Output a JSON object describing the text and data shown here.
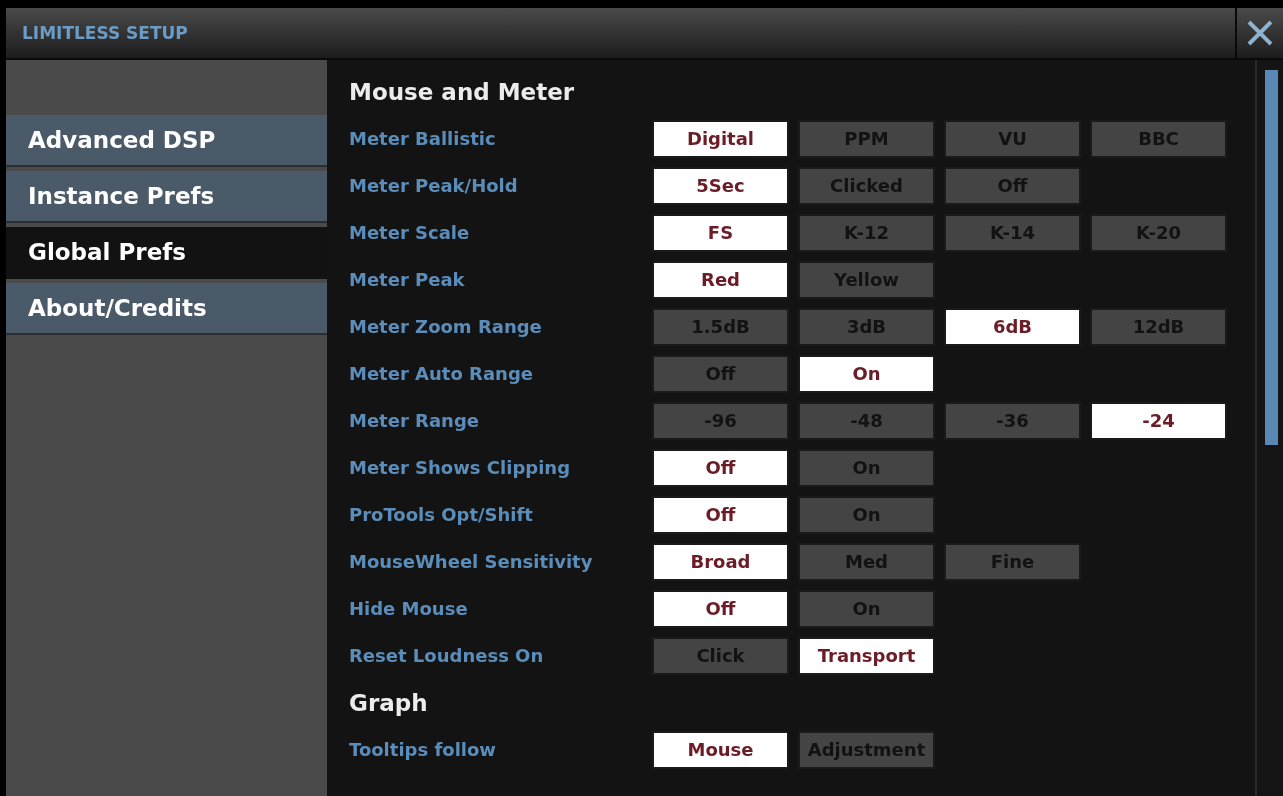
{
  "window": {
    "title": "LIMITLESS SETUP"
  },
  "sidebar": {
    "items": [
      {
        "label": "Advanced DSP",
        "selected": false
      },
      {
        "label": "Instance Prefs",
        "selected": false
      },
      {
        "label": "Global Prefs",
        "selected": true
      },
      {
        "label": "About/Credits",
        "selected": false
      }
    ]
  },
  "sections": [
    {
      "title": "Mouse and Meter",
      "settings": [
        {
          "label": "Meter Ballistic",
          "options": [
            {
              "label": "Digital",
              "selected": true
            },
            {
              "label": "PPM",
              "selected": false
            },
            {
              "label": "VU",
              "selected": false
            },
            {
              "label": "BBC",
              "selected": false
            }
          ]
        },
        {
          "label": "Meter Peak/Hold",
          "options": [
            {
              "label": "5Sec",
              "selected": true
            },
            {
              "label": "Clicked",
              "selected": false
            },
            {
              "label": "Off",
              "selected": false
            }
          ]
        },
        {
          "label": "Meter Scale",
          "options": [
            {
              "label": "FS",
              "selected": true
            },
            {
              "label": "K-12",
              "selected": false
            },
            {
              "label": "K-14",
              "selected": false
            },
            {
              "label": "K-20",
              "selected": false
            }
          ]
        },
        {
          "label": "Meter Peak",
          "options": [
            {
              "label": "Red",
              "selected": true
            },
            {
              "label": "Yellow",
              "selected": false
            }
          ]
        },
        {
          "label": "Meter Zoom Range",
          "options": [
            {
              "label": "1.5dB",
              "selected": false
            },
            {
              "label": "3dB",
              "selected": false
            },
            {
              "label": "6dB",
              "selected": true
            },
            {
              "label": "12dB",
              "selected": false
            }
          ]
        },
        {
          "label": "Meter Auto Range",
          "options": [
            {
              "label": "Off",
              "selected": false
            },
            {
              "label": "On",
              "selected": true
            }
          ]
        },
        {
          "label": "Meter Range",
          "options": [
            {
              "label": "-96",
              "selected": false
            },
            {
              "label": "-48",
              "selected": false
            },
            {
              "label": "-36",
              "selected": false
            },
            {
              "label": "-24",
              "selected": true
            }
          ]
        },
        {
          "label": "Meter Shows Clipping",
          "options": [
            {
              "label": "Off",
              "selected": true
            },
            {
              "label": "On",
              "selected": false
            }
          ]
        },
        {
          "label": "ProTools Opt/Shift",
          "options": [
            {
              "label": "Off",
              "selected": true
            },
            {
              "label": "On",
              "selected": false
            }
          ]
        },
        {
          "label": "MouseWheel Sensitivity",
          "options": [
            {
              "label": "Broad",
              "selected": true
            },
            {
              "label": "Med",
              "selected": false
            },
            {
              "label": "Fine",
              "selected": false
            }
          ]
        },
        {
          "label": "Hide Mouse",
          "options": [
            {
              "label": "Off",
              "selected": true
            },
            {
              "label": "On",
              "selected": false
            }
          ]
        },
        {
          "label": "Reset Loudness On",
          "options": [
            {
              "label": "Click",
              "selected": false
            },
            {
              "label": "Transport",
              "selected": true
            }
          ]
        }
      ]
    },
    {
      "title": "Graph",
      "settings": [
        {
          "label": "Tooltips follow",
          "options": [
            {
              "label": "Mouse",
              "selected": true
            },
            {
              "label": "Adjustment",
              "selected": false
            }
          ]
        }
      ]
    }
  ]
}
